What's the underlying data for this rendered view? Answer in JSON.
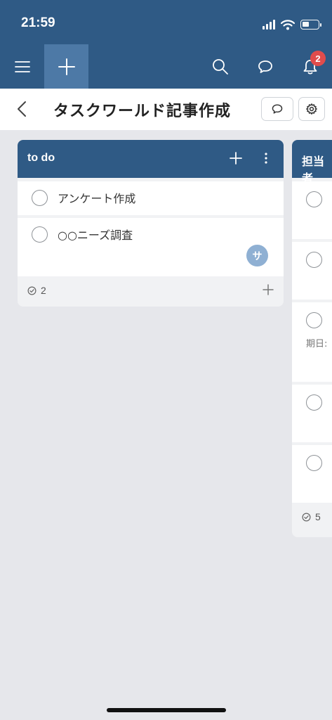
{
  "status_bar": {
    "time": "21:59"
  },
  "nav": {
    "menu_icon": "hamburger-icon",
    "add_icon": "plus-icon",
    "search_icon": "search-icon",
    "chat_icon": "chat-bubble-icon",
    "bell_icon": "bell-icon",
    "notification_count": "2"
  },
  "header": {
    "back_icon": "chevron-left-icon",
    "title": "タスクワールド記事作成",
    "chat_icon": "chat-bubble-icon",
    "settings_icon": "gear-icon"
  },
  "lists": [
    {
      "title": "to do",
      "tasks": [
        {
          "title": "アンケート作成"
        },
        {
          "title": "○○ニーズ調査",
          "assignee_initial": "サ"
        }
      ],
      "task_count": "2"
    },
    {
      "title": "担当者",
      "meta_label": "期日:",
      "task_count": "5"
    }
  ],
  "colors": {
    "nav_bg": "#2f5a85",
    "add_block": "#4d79a6",
    "badge": "#e04c4c",
    "canvas": "#e6e7eb",
    "assignee": "#8fb0d3"
  }
}
